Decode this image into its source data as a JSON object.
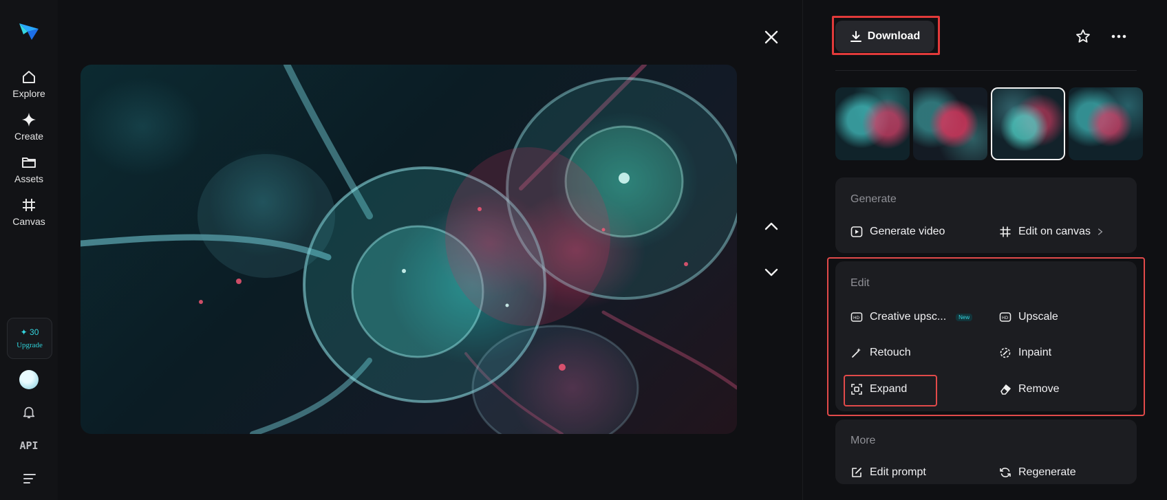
{
  "rail": {
    "items": [
      {
        "label": "Explore",
        "icon": "home-icon"
      },
      {
        "label": "Create",
        "icon": "sparkle-icon"
      },
      {
        "label": "Assets",
        "icon": "folder-icon"
      },
      {
        "label": "Canvas",
        "icon": "canvas-icon"
      }
    ],
    "credits": {
      "count": "✦ 30",
      "upgrade": "Upgrade"
    },
    "api": "API"
  },
  "viewer": {
    "image_alt": "Glowing teal and crimson cells connected by fibrous strands"
  },
  "panel": {
    "download": "Download",
    "generate": {
      "title": "Generate",
      "actions": [
        "Generate video",
        "Edit on canvas"
      ]
    },
    "edit": {
      "title": "Edit",
      "actions": [
        "Creative upsc...",
        "Upscale",
        "Retouch",
        "Inpaint",
        "Expand",
        "Remove"
      ],
      "new_badge": "New"
    },
    "more": {
      "title": "More",
      "actions": [
        "Edit prompt",
        "Regenerate"
      ]
    }
  },
  "colors": {
    "accent": "#35d6e0",
    "highlight": "#e23a3a",
    "bg": "#0f1013",
    "card": "#1c1d21"
  }
}
